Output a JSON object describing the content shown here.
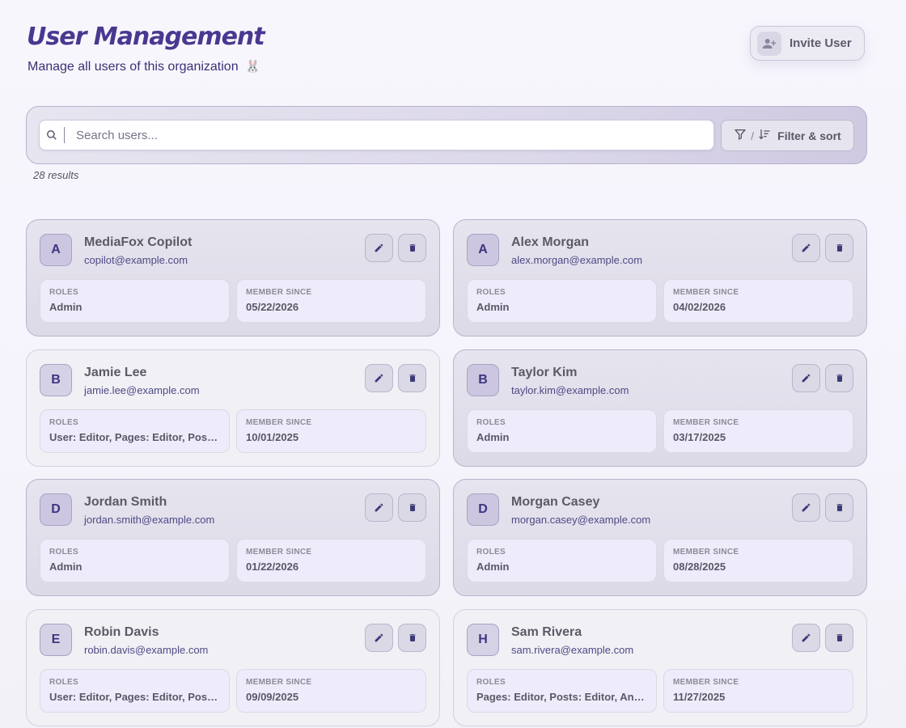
{
  "header": {
    "title": "User Management",
    "subtitle": "Manage all users of this organization",
    "subtitle_emoji": "🐰",
    "invite_label": "Invite User"
  },
  "search": {
    "placeholder": "Search users...",
    "value": "",
    "filter_label": "Filter & sort",
    "filter_separator": "/"
  },
  "results_label": "28 results",
  "labels": {
    "roles": "ROLES",
    "member_since": "MEMBER SINCE"
  },
  "colors": {
    "accent": "#4a3890",
    "avatar_bg": "#ccc6e0",
    "email": "#4d4a85"
  },
  "icons": {
    "invite": "user-plus-icon",
    "search": "search-icon",
    "filter": "filter-icon",
    "sort": "sort-icon",
    "edit": "pencil-icon",
    "delete": "trash-icon"
  },
  "users": [
    {
      "initial": "A",
      "name": "MediaFox Copilot",
      "email": "copilot@example.com",
      "roles": "Admin",
      "member_since": "05/22/2026"
    },
    {
      "initial": "A",
      "name": "Alex Morgan",
      "email": "alex.morgan@example.com",
      "roles": "Admin",
      "member_since": "04/02/2026"
    },
    {
      "initial": "B",
      "name": "Jamie Lee",
      "email": "jamie.lee@example.com",
      "roles": "User: Editor, Pages: Editor, Posts: Editor",
      "member_since": "10/01/2025"
    },
    {
      "initial": "B",
      "name": "Taylor Kim",
      "email": "taylor.kim@example.com",
      "roles": "Admin",
      "member_since": "03/17/2025"
    },
    {
      "initial": "D",
      "name": "Jordan Smith",
      "email": "jordan.smith@example.com",
      "roles": "Admin",
      "member_since": "01/22/2026"
    },
    {
      "initial": "D",
      "name": "Morgan Casey",
      "email": "morgan.casey@example.com",
      "roles": "Admin",
      "member_since": "08/28/2025"
    },
    {
      "initial": "E",
      "name": "Robin Davis",
      "email": "robin.davis@example.com",
      "roles": "User: Editor, Pages: Editor, Posts: Editor",
      "member_since": "09/09/2025"
    },
    {
      "initial": "H",
      "name": "Sam Rivera",
      "email": "sam.rivera@example.com",
      "roles": "Pages: Editor, Posts: Editor, Analytics: Viewer",
      "member_since": "11/27/2025"
    }
  ]
}
